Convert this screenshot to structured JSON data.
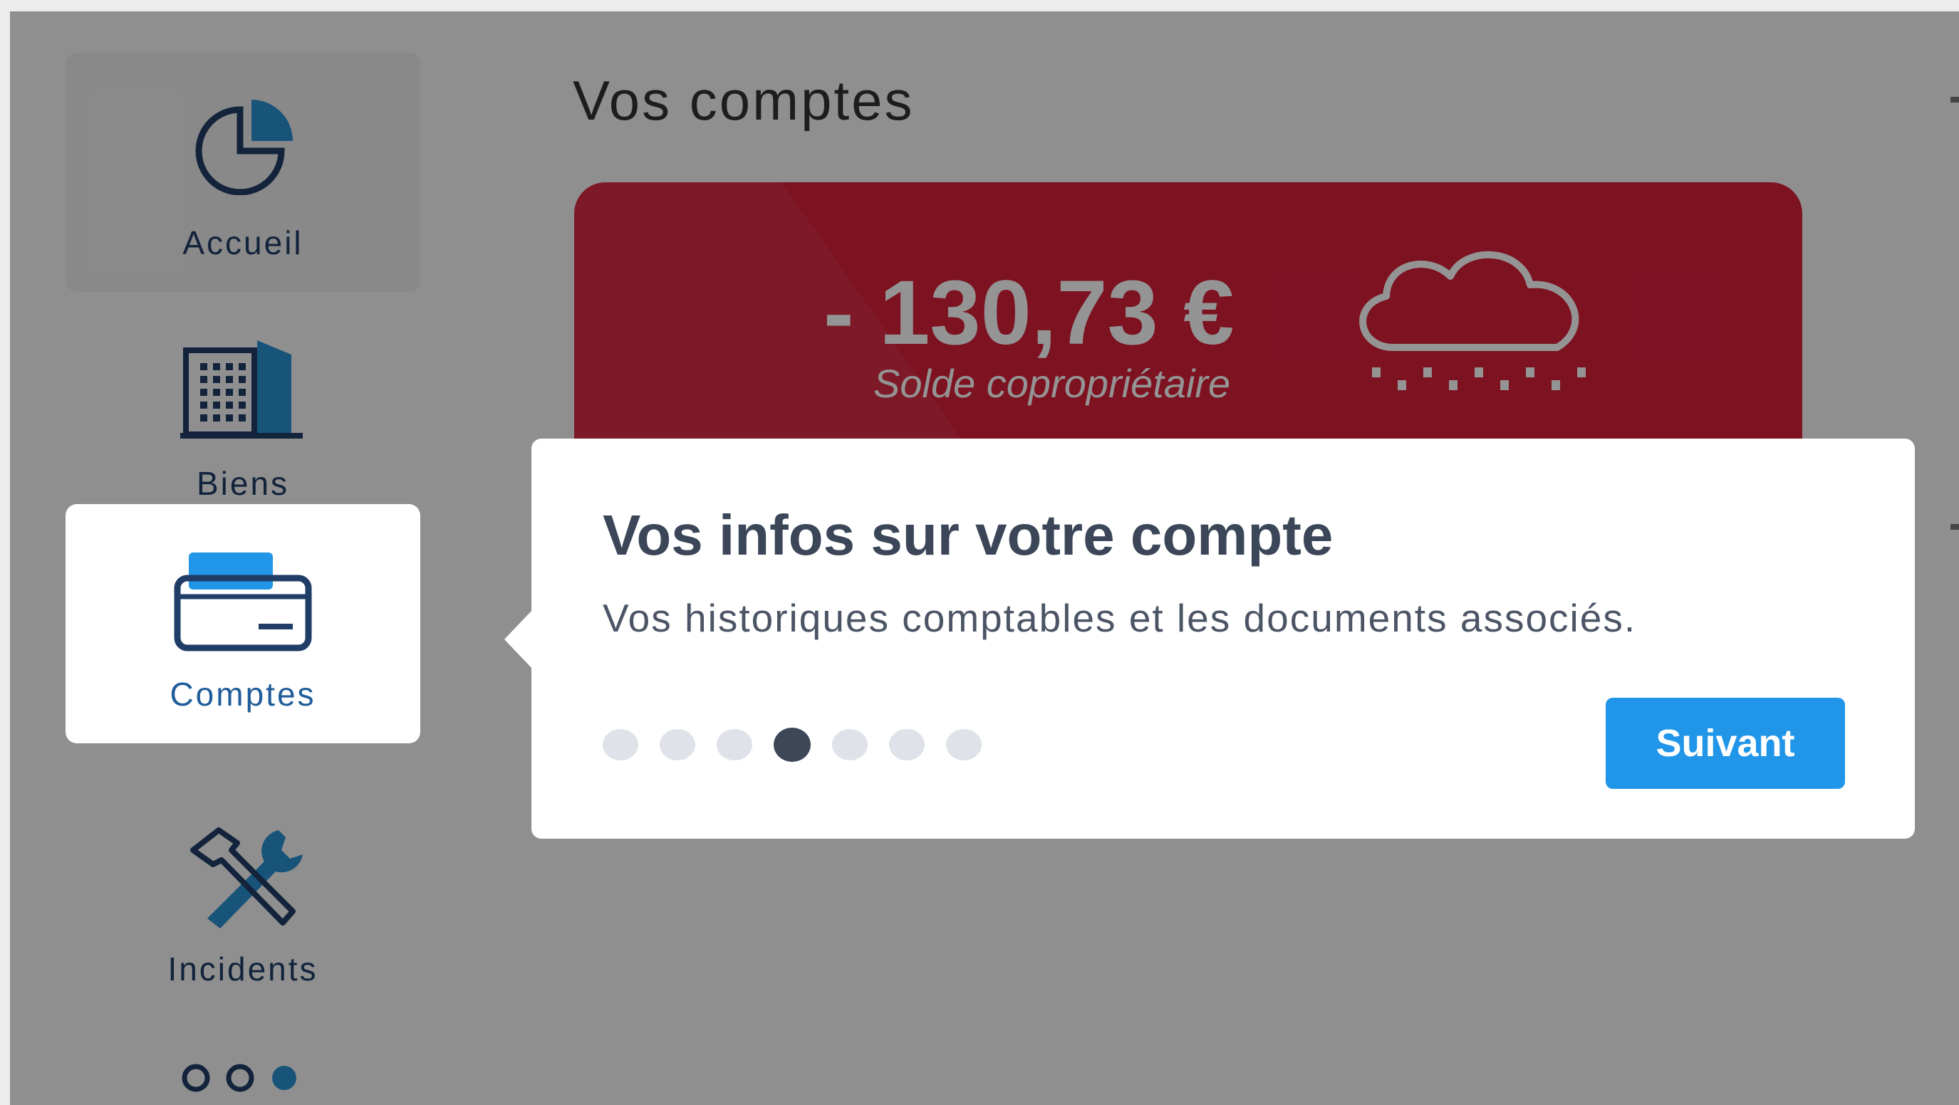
{
  "sidebar": {
    "items": [
      {
        "label": "Accueil",
        "icon": "pie-chart-icon"
      },
      {
        "label": "Biens",
        "icon": "building-icon"
      },
      {
        "label": "Comptes",
        "icon": "wallet-icon",
        "active": true
      },
      {
        "label": "Incidents",
        "icon": "tools-icon"
      },
      {
        "label": "",
        "icon": "more-dots-icon"
      }
    ]
  },
  "main": {
    "title": "Vos comptes",
    "balance": {
      "amount": "- 130,73 €",
      "label": "Solde copropriétaire",
      "icon": "rain-cloud-icon",
      "color": "#d8203a"
    }
  },
  "tour": {
    "title": "Vos infos sur votre compte",
    "description": "Vos historiques comptables et les documents associés.",
    "steps_total": 7,
    "current_step": 4,
    "next_label": "Suivant",
    "button_color": "#2196e8"
  }
}
